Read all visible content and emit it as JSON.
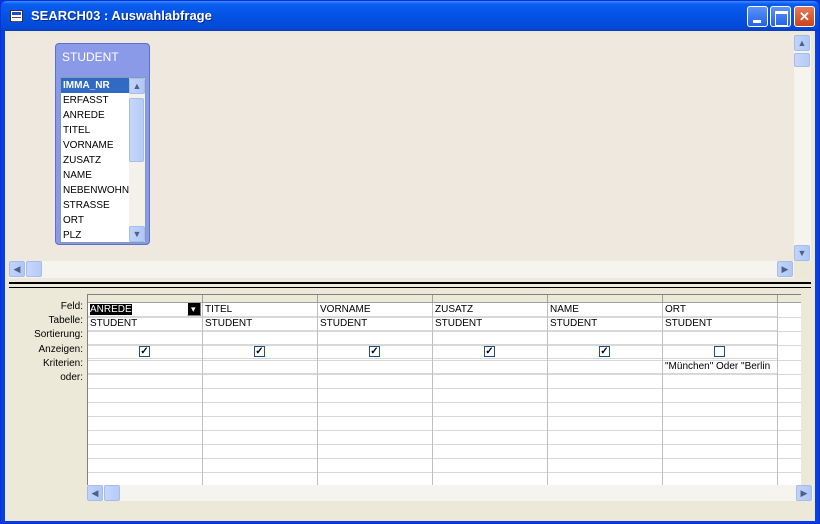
{
  "window": {
    "title": "SEARCH03 : Auswahlabfrage"
  },
  "table_box": {
    "title": "STUDENT",
    "fields": [
      "IMMA_NR",
      "ERFASST",
      "ANREDE",
      "TITEL",
      "VORNAME",
      "ZUSATZ",
      "NAME",
      "NEBENWOHN",
      "STRASSE",
      "ORT",
      "PLZ"
    ],
    "selected_index": 0
  },
  "grid": {
    "row_labels": [
      "Feld:",
      "Tabelle:",
      "Sortierung:",
      "Anzeigen:",
      "Kriterien:",
      "oder:"
    ],
    "columns": [
      {
        "field": "ANREDE",
        "table": "STUDENT",
        "sort": "",
        "show": true,
        "criteria": ""
      },
      {
        "field": "TITEL",
        "table": "STUDENT",
        "sort": "",
        "show": true,
        "criteria": ""
      },
      {
        "field": "VORNAME",
        "table": "STUDENT",
        "sort": "",
        "show": true,
        "criteria": ""
      },
      {
        "field": "ZUSATZ",
        "table": "STUDENT",
        "sort": "",
        "show": true,
        "criteria": ""
      },
      {
        "field": "NAME",
        "table": "STUDENT",
        "sort": "",
        "show": true,
        "criteria": ""
      },
      {
        "field": "ORT",
        "table": "STUDENT",
        "sort": "",
        "show": false,
        "criteria": "\"München\" Oder \"Berlin"
      }
    ]
  },
  "icons": {
    "app": "query-icon",
    "minimize": "minimize-icon",
    "maximize": "maximize-icon",
    "close": "close-icon"
  },
  "colors": {
    "titlebar": "#0452e4",
    "table_box": "#8b9ae8",
    "selection": "#316ac5"
  }
}
